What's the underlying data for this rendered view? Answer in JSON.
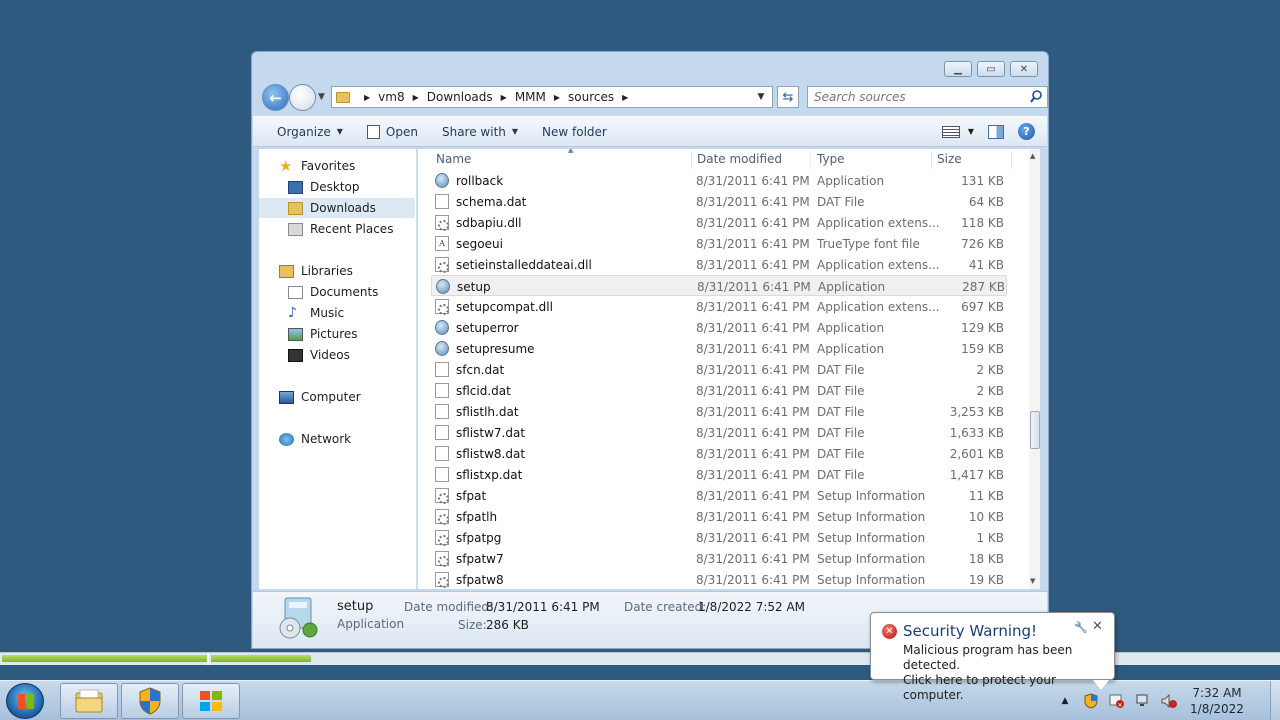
{
  "window": {
    "caption_buttons": [
      "minimize",
      "maximize",
      "close"
    ],
    "breadcrumb": [
      "vm8",
      "Downloads",
      "MMM",
      "sources"
    ],
    "search_placeholder": "Search sources"
  },
  "toolbar": {
    "organize": "Organize",
    "open": "Open",
    "share_with": "Share with",
    "new_folder": "New folder"
  },
  "nav": {
    "favorites": "Favorites",
    "desktop": "Desktop",
    "downloads": "Downloads",
    "recent_places": "Recent Places",
    "libraries": "Libraries",
    "documents": "Documents",
    "music": "Music",
    "pictures": "Pictures",
    "videos": "Videos",
    "computer": "Computer",
    "network": "Network"
  },
  "columns": {
    "name": "Name",
    "date": "Date modified",
    "type": "Type",
    "size": "Size"
  },
  "files": [
    {
      "name": "rollback",
      "date": "8/31/2011 6:41 PM",
      "type": "Application",
      "size": "131 KB",
      "icon": "app"
    },
    {
      "name": "schema.dat",
      "date": "8/31/2011 6:41 PM",
      "type": "DAT File",
      "size": "64 KB",
      "icon": "file"
    },
    {
      "name": "sdbapiu.dll",
      "date": "8/31/2011 6:41 PM",
      "type": "Application extens...",
      "size": "118 KB",
      "icon": "gear"
    },
    {
      "name": "segoeui",
      "date": "8/31/2011 6:41 PM",
      "type": "TrueType font file",
      "size": "726 KB",
      "icon": "font"
    },
    {
      "name": "setieinstalleddateai.dll",
      "date": "8/31/2011 6:41 PM",
      "type": "Application extens...",
      "size": "41 KB",
      "icon": "gear"
    },
    {
      "name": "setup",
      "date": "8/31/2011 6:41 PM",
      "type": "Application",
      "size": "287 KB",
      "icon": "app",
      "selected": true
    },
    {
      "name": "setupcompat.dll",
      "date": "8/31/2011 6:41 PM",
      "type": "Application extens...",
      "size": "697 KB",
      "icon": "gear"
    },
    {
      "name": "setuperror",
      "date": "8/31/2011 6:41 PM",
      "type": "Application",
      "size": "129 KB",
      "icon": "app"
    },
    {
      "name": "setupresume",
      "date": "8/31/2011 6:41 PM",
      "type": "Application",
      "size": "159 KB",
      "icon": "app"
    },
    {
      "name": "sfcn.dat",
      "date": "8/31/2011 6:41 PM",
      "type": "DAT File",
      "size": "2 KB",
      "icon": "file"
    },
    {
      "name": "sflcid.dat",
      "date": "8/31/2011 6:41 PM",
      "type": "DAT File",
      "size": "2 KB",
      "icon": "file"
    },
    {
      "name": "sflistlh.dat",
      "date": "8/31/2011 6:41 PM",
      "type": "DAT File",
      "size": "3,253 KB",
      "icon": "file"
    },
    {
      "name": "sflistw7.dat",
      "date": "8/31/2011 6:41 PM",
      "type": "DAT File",
      "size": "1,633 KB",
      "icon": "file"
    },
    {
      "name": "sflistw8.dat",
      "date": "8/31/2011 6:41 PM",
      "type": "DAT File",
      "size": "2,601 KB",
      "icon": "file"
    },
    {
      "name": "sflistxp.dat",
      "date": "8/31/2011 6:41 PM",
      "type": "DAT File",
      "size": "1,417 KB",
      "icon": "file"
    },
    {
      "name": "sfpat",
      "date": "8/31/2011 6:41 PM",
      "type": "Setup Information",
      "size": "11 KB",
      "icon": "gear"
    },
    {
      "name": "sfpatlh",
      "date": "8/31/2011 6:41 PM",
      "type": "Setup Information",
      "size": "10 KB",
      "icon": "gear"
    },
    {
      "name": "sfpatpg",
      "date": "8/31/2011 6:41 PM",
      "type": "Setup Information",
      "size": "1 KB",
      "icon": "gear"
    },
    {
      "name": "sfpatw7",
      "date": "8/31/2011 6:41 PM",
      "type": "Setup Information",
      "size": "18 KB",
      "icon": "gear"
    },
    {
      "name": "sfpatw8",
      "date": "8/31/2011 6:41 PM",
      "type": "Setup Information",
      "size": "19 KB",
      "icon": "gear"
    }
  ],
  "details": {
    "name": "setup",
    "type": "Application",
    "date_modified_label": "Date modified:",
    "date_modified": "8/31/2011 6:41 PM",
    "date_created_label": "Date created:",
    "date_created": "1/8/2022 7:52 AM",
    "size_label": "Size:",
    "size": "286 KB"
  },
  "balloon": {
    "title": "Security Warning!",
    "line1": "Malicious program has been detected.",
    "line2": "Click here to protect your computer."
  },
  "clock": {
    "time": "7:32 AM",
    "date": "1/8/2022"
  },
  "colors": {
    "desktop": "#2f5a80",
    "selection": "#dde8f5",
    "progress": "#7fb52a",
    "warning": "#b3120a"
  }
}
